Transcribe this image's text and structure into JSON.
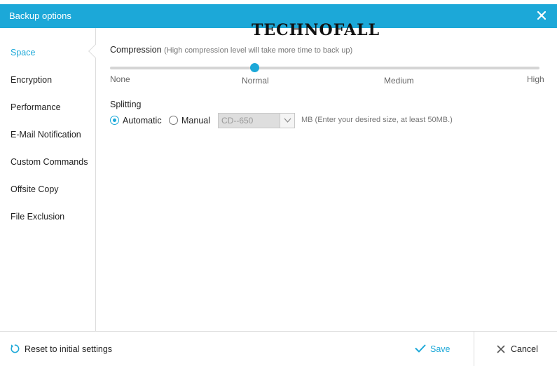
{
  "window": {
    "title": "Backup options",
    "close_icon": "close-icon",
    "accent_color": "#1ca8d8"
  },
  "watermark": "TECHNOFALL",
  "sidebar": {
    "items": [
      {
        "label": "Space",
        "active": true
      },
      {
        "label": "Encryption"
      },
      {
        "label": "Performance"
      },
      {
        "label": "E-Mail Notification"
      },
      {
        "label": "Custom Commands"
      },
      {
        "label": "Offsite Copy"
      },
      {
        "label": "File Exclusion"
      }
    ]
  },
  "compression": {
    "label": "Compression",
    "hint": "(High compression level will take more time to back up)",
    "levels": [
      "None",
      "Normal",
      "Medium",
      "High"
    ],
    "selected": "Normal"
  },
  "splitting": {
    "label": "Splitting",
    "options": [
      {
        "label": "Automatic",
        "checked": true
      },
      {
        "label": "Manual",
        "checked": false
      }
    ],
    "size_select": {
      "value": "CD--650",
      "disabled": true
    },
    "size_hint": "MB (Enter your desired size, at least 50MB.)"
  },
  "footer": {
    "reset_label": "Reset to initial settings",
    "save_label": "Save",
    "cancel_label": "Cancel",
    "icons": {
      "reset": "reset-icon",
      "save": "checkmark-icon",
      "cancel": "close-icon"
    }
  }
}
